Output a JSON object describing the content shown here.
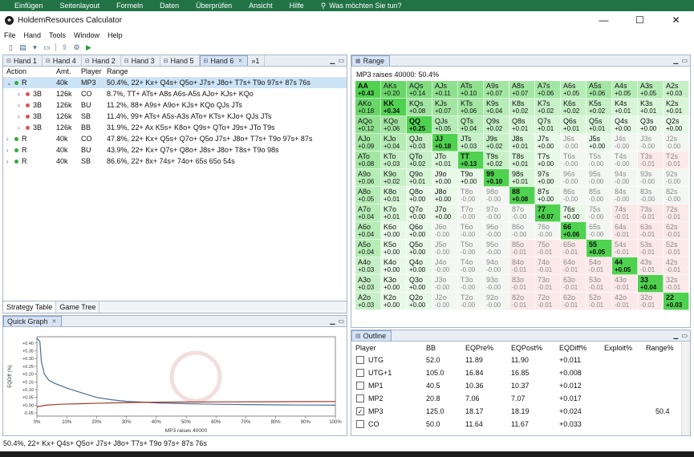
{
  "excel_ribbon": {
    "items": [
      "Einfügen",
      "Seitenlayout",
      "Formeln",
      "Daten",
      "Überprüfen",
      "Ansicht",
      "Hilfe"
    ],
    "search": "Was möchten Sie tun?"
  },
  "window": {
    "title": "HoldemResources Calculator",
    "min": "—",
    "max": "☐",
    "close": "✕"
  },
  "menu": [
    "File",
    "Hand",
    "Tools",
    "Window",
    "Help"
  ],
  "hand_tabs": [
    "Hand 1",
    "Hand 4",
    "Hand 2",
    "Hand 3",
    "Hand 5",
    "Hand 6",
    "»1"
  ],
  "strategy": {
    "headers": [
      "Action",
      "Amt.",
      "Player",
      "Range"
    ],
    "rows": [
      {
        "chev": "⌄",
        "dot": "#2fae3c",
        "action": "R",
        "amt": "40k",
        "player": "MP3",
        "range": "50.4%, 22+ Kx+ Q4s+ Q5o+ J7s+ J8o+ T7s+ T9o 97s+ 87s 76s",
        "sel": true,
        "indent": false
      },
      {
        "chev": "›",
        "dot": "#d9534f",
        "action": "3B",
        "amt": "126k",
        "player": "CO",
        "range": "8.7%, TT+ ATs+ A8s A6s-A5s AJo+ KJs+ KQo",
        "sel": false,
        "indent": true
      },
      {
        "chev": "›",
        "dot": "#d9534f",
        "action": "3B",
        "amt": "126k",
        "player": "BU",
        "range": "11.2%, 88+ A9s+ A9o+ KJs+ KQo QJs JTs",
        "sel": false,
        "indent": true
      },
      {
        "chev": "›",
        "dot": "#d9534f",
        "action": "3B",
        "amt": "126k",
        "player": "SB",
        "range": "11.4%, 99+ ATs+ A5s-A3s ATo+ KTs+ KJo+ QJs JTs",
        "sel": false,
        "indent": true
      },
      {
        "chev": "›",
        "dot": "#d9534f",
        "action": "3B",
        "amt": "126k",
        "player": "BB",
        "range": "31.9%, 22+ Ax K5s+ K8o+ Q9s+ QTo+ J9s+ JTo T9s",
        "sel": false,
        "indent": true
      },
      {
        "chev": "›",
        "dot": "#2fae3c",
        "action": "R",
        "amt": "40k",
        "player": "CO",
        "range": "47.8%, 22+ Kx+ Q5s+ Q7o+ Q5o J7s+ J8o+ T7s+ T9o 97s+ 87s",
        "sel": false,
        "indent": false
      },
      {
        "chev": "›",
        "dot": "#2fae3c",
        "action": "R",
        "amt": "40k",
        "player": "BU",
        "range": "43.9%, 22+ Kx+ Q7s+ Q8o+ J8s+ J8o+ T8s+ T9o 98s",
        "sel": false,
        "indent": false
      },
      {
        "chev": "›",
        "dot": "#2fae3c",
        "action": "R",
        "amt": "40k",
        "player": "SB",
        "range": "86.6%, 22+ 8x+ 74s+ 74o+ 65s 65o 54s",
        "sel": false,
        "indent": false
      }
    ]
  },
  "bottom_tabs": [
    "Strategy Table",
    "Game Tree"
  ],
  "quick_graph": {
    "title": "Quick Graph",
    "xlabel": "MP3 raises 40000",
    "ylabel": "EQDiff (%)"
  },
  "chart_data": {
    "type": "line",
    "xlabel": "MP3 raises 40000",
    "ylabel": "EQDiff (%)",
    "x_ticks": [
      "0%",
      "10%",
      "20%",
      "30%",
      "40%",
      "50%",
      "60%",
      "70%",
      "80%",
      "90%",
      "100%"
    ],
    "y_ticks": [
      "+0.40",
      "+0.35",
      "+0.30",
      "+0.25",
      "+0.20",
      "+0.15",
      "+0.10",
      "+0.05",
      "+0.00",
      "-0.05"
    ],
    "ylim": [
      -0.07,
      0.44
    ],
    "series": [
      {
        "color": "#4a6f96",
        "points": [
          [
            0,
            0.43
          ],
          [
            1,
            0.41
          ],
          [
            1.5,
            0.28
          ],
          [
            2.5,
            0.2
          ],
          [
            4,
            0.16
          ],
          [
            6,
            0.14
          ],
          [
            10,
            0.11
          ],
          [
            15,
            0.08
          ],
          [
            20,
            0.05
          ],
          [
            25,
            0.035
          ],
          [
            30,
            0.025
          ],
          [
            35,
            0.02
          ],
          [
            40,
            0.015
          ],
          [
            50,
            0.01
          ],
          [
            60,
            0.006
          ],
          [
            70,
            0.004
          ],
          [
            80,
            0.002
          ],
          [
            90,
            0.001
          ],
          [
            100,
            0.0
          ]
        ]
      },
      {
        "color": "#a23b2b",
        "points": [
          [
            0,
            -0.01
          ],
          [
            3,
            0.0
          ],
          [
            8,
            0.006
          ],
          [
            15,
            0.01
          ],
          [
            25,
            0.015
          ],
          [
            35,
            0.018
          ],
          [
            45,
            0.02
          ],
          [
            60,
            0.021
          ],
          [
            75,
            0.022
          ],
          [
            90,
            0.023
          ],
          [
            100,
            0.024
          ]
        ]
      }
    ]
  },
  "range_panel": {
    "title": "Range",
    "caption": "MP3 raises 40000: 50.4%"
  },
  "range_grid": [
    [
      [
        "AA",
        "+0.43",
        9
      ],
      [
        "AKs",
        "+0.20",
        8
      ],
      [
        "AQs",
        "+0.14",
        7
      ],
      [
        "AJs",
        "+0.11",
        6
      ],
      [
        "ATs",
        "+0.10",
        6
      ],
      [
        "A9s",
        "+0.07",
        5
      ],
      [
        "A8s",
        "+0.07",
        5
      ],
      [
        "A7s",
        "+0.06",
        5
      ],
      [
        "A6s",
        "+0.05",
        4
      ],
      [
        "A5s",
        "+0.06",
        5
      ],
      [
        "A4s",
        "+0.05",
        4
      ],
      [
        "A3s",
        "+0.05",
        4
      ],
      [
        "A2s",
        "+0.03",
        3
      ]
    ],
    [
      [
        "AKo",
        "+0.18",
        8
      ],
      [
        "KK",
        "+0.34",
        9
      ],
      [
        "KQs",
        "+0.08",
        5
      ],
      [
        "KJs",
        "+0.07",
        5
      ],
      [
        "KTs",
        "+0.06",
        5
      ],
      [
        "K9s",
        "+0.04",
        4
      ],
      [
        "K8s",
        "+0.02",
        3
      ],
      [
        "K7s",
        "+0.02",
        3
      ],
      [
        "K6s",
        "+0.02",
        3
      ],
      [
        "K5s",
        "+0.02",
        3
      ],
      [
        "K4s",
        "+0.01",
        2
      ],
      [
        "K3s",
        "+0.01",
        2
      ],
      [
        "K2s",
        "+0.01",
        2
      ]
    ],
    [
      [
        "AQo",
        "+0.12",
        6
      ],
      [
        "KQo",
        "+0.06",
        5
      ],
      [
        "QQ",
        "+0.25",
        9
      ],
      [
        "QJs",
        "+0.05",
        4
      ],
      [
        "QTs",
        "+0.04",
        4
      ],
      [
        "Q9s",
        "+0.02",
        3
      ],
      [
        "Q8s",
        "+0.01",
        2
      ],
      [
        "Q7s",
        "+0.01",
        2
      ],
      [
        "Q6s",
        "+0.01",
        2
      ],
      [
        "Q5s",
        "+0.01",
        2
      ],
      [
        "Q4s",
        "+0.00",
        1
      ],
      [
        "Q3s",
        "+0.00",
        1
      ],
      [
        "Q2s",
        "+0.00",
        1
      ]
    ],
    [
      [
        "AJo",
        "+0.09",
        5
      ],
      [
        "KJo",
        "+0.04",
        4
      ],
      [
        "QJo",
        "+0.03",
        3
      ],
      [
        "JJ",
        "+0.18",
        9
      ],
      [
        "JTs",
        "+0.03",
        3
      ],
      [
        "J9s",
        "+0.02",
        3
      ],
      [
        "J8s",
        "+0.01",
        2
      ],
      [
        "J7s",
        "+0.00",
        1
      ],
      [
        "J6s",
        "-0.00",
        0
      ],
      [
        "J5s",
        "+0.00",
        1
      ],
      [
        "J4s",
        "-0.00",
        0
      ],
      [
        "J3s",
        "-0.00",
        0
      ],
      [
        "J2s",
        "-0.00",
        0
      ]
    ],
    [
      [
        "ATo",
        "+0.08",
        5
      ],
      [
        "KTo",
        "+0.03",
        3
      ],
      [
        "QTo",
        "+0.02",
        3
      ],
      [
        "JTo",
        "+0.01",
        2
      ],
      [
        "TT",
        "+0.13",
        9
      ],
      [
        "T9s",
        "+0.02",
        3
      ],
      [
        "T8s",
        "+0.01",
        2
      ],
      [
        "T7s",
        "+0.00",
        1
      ],
      [
        "T6s",
        "-0.00",
        0
      ],
      [
        "T5s",
        "-0.00",
        0
      ],
      [
        "T4s",
        "-0.00",
        0
      ],
      [
        "T3s",
        "-0.01",
        -1
      ],
      [
        "T2s",
        "-0.01",
        -1
      ]
    ],
    [
      [
        "A9o",
        "+0.06",
        4
      ],
      [
        "K9o",
        "+0.02",
        3
      ],
      [
        "Q9o",
        "+0.01",
        2
      ],
      [
        "J9o",
        "+0.00",
        1
      ],
      [
        "T9o",
        "+0.00",
        1
      ],
      [
        "99",
        "+0.10",
        9
      ],
      [
        "98s",
        "+0.01",
        2
      ],
      [
        "97s",
        "+0.00",
        1
      ],
      [
        "96s",
        "-0.00",
        0
      ],
      [
        "95s",
        "-0.00",
        0
      ],
      [
        "94s",
        "-0.00",
        0
      ],
      [
        "93s",
        "-0.00",
        0
      ],
      [
        "92s",
        "-0.00",
        0
      ]
    ],
    [
      [
        "A8o",
        "+0.05",
        4
      ],
      [
        "K8o",
        "+0.01",
        2
      ],
      [
        "Q8o",
        "+0.00",
        1
      ],
      [
        "J8o",
        "+0.00",
        1
      ],
      [
        "T8o",
        "-0.00",
        0
      ],
      [
        "98o",
        "-0.00",
        0
      ],
      [
        "88",
        "+0.08",
        9
      ],
      [
        "87s",
        "+0.00",
        1
      ],
      [
        "86s",
        "-0.00",
        0
      ],
      [
        "85s",
        "-0.00",
        0
      ],
      [
        "84s",
        "-0.00",
        0
      ],
      [
        "83s",
        "-0.00",
        0
      ],
      [
        "82s",
        "-0.00",
        0
      ]
    ],
    [
      [
        "A7o",
        "+0.04",
        4
      ],
      [
        "K7o",
        "+0.01",
        2
      ],
      [
        "Q7o",
        "+0.00",
        1
      ],
      [
        "J7o",
        "+0.00",
        1
      ],
      [
        "T7o",
        "-0.00",
        0
      ],
      [
        "97o",
        "-0.00",
        0
      ],
      [
        "87o",
        "-0.00",
        0
      ],
      [
        "77",
        "+0.07",
        9
      ],
      [
        "76s",
        "+0.00",
        1
      ],
      [
        "75s",
        "-0.00",
        0
      ],
      [
        "74s",
        "-0.01",
        -1
      ],
      [
        "73s",
        "-0.01",
        -1
      ],
      [
        "72s",
        "-0.01",
        -1
      ]
    ],
    [
      [
        "A6o",
        "+0.04",
        4
      ],
      [
        "K6o",
        "+0.00",
        1
      ],
      [
        "Q6o",
        "+0.00",
        1
      ],
      [
        "J6o",
        "-0.00",
        0
      ],
      [
        "T6o",
        "-0.00",
        0
      ],
      [
        "96o",
        "-0.00",
        0
      ],
      [
        "86o",
        "-0.00",
        0
      ],
      [
        "76o",
        "-0.00",
        0
      ],
      [
        "66",
        "+0.06",
        9
      ],
      [
        "65s",
        "-0.00",
        0
      ],
      [
        "64s",
        "-0.01",
        -1
      ],
      [
        "63s",
        "-0.01",
        -1
      ],
      [
        "62s",
        "-0.01",
        -1
      ]
    ],
    [
      [
        "A5o",
        "+0.04",
        4
      ],
      [
        "K5o",
        "+0.00",
        1
      ],
      [
        "Q5o",
        "+0.00",
        1
      ],
      [
        "J5o",
        "-0.00",
        0
      ],
      [
        "T5o",
        "-0.00",
        0
      ],
      [
        "95o",
        "-0.00",
        0
      ],
      [
        "85o",
        "-0.01",
        -1
      ],
      [
        "75o",
        "-0.01",
        -1
      ],
      [
        "65o",
        "-0.01",
        -1
      ],
      [
        "55",
        "+0.05",
        9
      ],
      [
        "54s",
        "-0.01",
        -1
      ],
      [
        "53s",
        "-0.01",
        -1
      ],
      [
        "52s",
        "-0.01",
        -1
      ]
    ],
    [
      [
        "A4o",
        "+0.03",
        3
      ],
      [
        "K4o",
        "+0.00",
        1
      ],
      [
        "Q4o",
        "+0.00",
        1
      ],
      [
        "J4o",
        "-0.00",
        0
      ],
      [
        "T4o",
        "-0.00",
        0
      ],
      [
        "94o",
        "-0.00",
        0
      ],
      [
        "84o",
        "-0.01",
        -1
      ],
      [
        "74o",
        "-0.01",
        -1
      ],
      [
        "64o",
        "-0.01",
        -1
      ],
      [
        "54o",
        "-0.01",
        -1
      ],
      [
        "44",
        "+0.05",
        9
      ],
      [
        "43s",
        "-0.01",
        -1
      ],
      [
        "42s",
        "-0.01",
        -1
      ]
    ],
    [
      [
        "A3o",
        "+0.03",
        3
      ],
      [
        "K3o",
        "+0.00",
        1
      ],
      [
        "Q3o",
        "+0.00",
        1
      ],
      [
        "J3o",
        "-0.00",
        0
      ],
      [
        "T3o",
        "-0.00",
        0
      ],
      [
        "93o",
        "-0.00",
        0
      ],
      [
        "83o",
        "-0.01",
        -1
      ],
      [
        "73o",
        "-0.01",
        -1
      ],
      [
        "63o",
        "-0.01",
        -1
      ],
      [
        "53o",
        "-0.01",
        -1
      ],
      [
        "43o",
        "-0.01",
        -1
      ],
      [
        "33",
        "+0.04",
        9
      ],
      [
        "32s",
        "-0.01",
        -1
      ]
    ],
    [
      [
        "A2o",
        "+0.03",
        3
      ],
      [
        "K2o",
        "+0.00",
        1
      ],
      [
        "Q2o",
        "+0.00",
        1
      ],
      [
        "J2o",
        "-0.00",
        0
      ],
      [
        "T2o",
        "-0.00",
        0
      ],
      [
        "92o",
        "-0.00",
        0
      ],
      [
        "82o",
        "-0.01",
        -1
      ],
      [
        "72o",
        "-0.01",
        -1
      ],
      [
        "62o",
        "-0.01",
        -1
      ],
      [
        "52o",
        "-0.01",
        -1
      ],
      [
        "42o",
        "-0.01",
        -1
      ],
      [
        "32o",
        "-0.01",
        -1
      ],
      [
        "22",
        "+0.03",
        9
      ]
    ]
  ],
  "outline": {
    "title": "Outline",
    "headers": [
      "Player",
      "BB",
      "EQPre%",
      "EQPost%",
      "EQDiff%",
      "Exploit%",
      "Range%"
    ],
    "rows": [
      {
        "checked": false,
        "player": "UTG",
        "bb": "52.0",
        "pre": "11.89",
        "post": "11.90",
        "diff": "+0.011",
        "exploit": "",
        "range": ""
      },
      {
        "checked": false,
        "player": "UTG+1",
        "bb": "105.0",
        "pre": "16.84",
        "post": "16.85",
        "diff": "+0.008",
        "exploit": "",
        "range": ""
      },
      {
        "checked": false,
        "player": "MP1",
        "bb": "40.5",
        "pre": "10.36",
        "post": "10.37",
        "diff": "+0.012",
        "exploit": "",
        "range": ""
      },
      {
        "checked": false,
        "player": "MP2",
        "bb": "20.8",
        "pre": "7.06",
        "post": "7.07",
        "diff": "+0.017",
        "exploit": "",
        "range": ""
      },
      {
        "checked": true,
        "player": "MP3",
        "bb": "125.0",
        "pre": "18.17",
        "post": "18.19",
        "diff": "+0.024",
        "exploit": "",
        "range": "50.4"
      },
      {
        "checked": false,
        "player": "CO",
        "bb": "50.0",
        "pre": "11.64",
        "post": "11.67",
        "diff": "+0.033",
        "exploit": "",
        "range": ""
      }
    ]
  },
  "status": "50.4%, 22+ Kx+ Q4s+ Q5o+ J7s+ J8o+ T7s+ T9o 97s+ 87s 76s"
}
